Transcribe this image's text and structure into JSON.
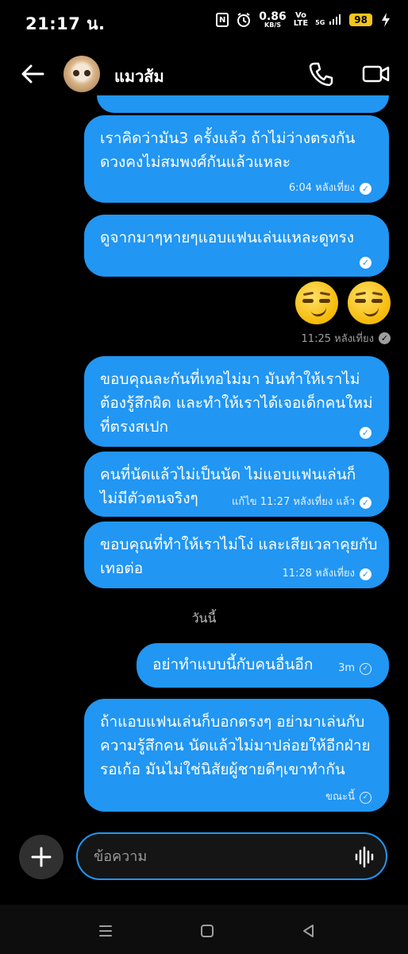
{
  "status": {
    "time": "21:17 น.",
    "net_speed": "0.86",
    "net_unit": "KB/S",
    "volte_top": "Vo",
    "volte_bottom": "LTE",
    "network": "5G",
    "battery": "98",
    "icons": [
      "nfc-icon",
      "alarm-icon",
      "signal-icon",
      "wifi-icon",
      "battery-icon"
    ]
  },
  "header": {
    "contact_name": "แมวส้ม",
    "icons": [
      "back-arrow-icon",
      "phone-icon",
      "video-call-icon"
    ]
  },
  "messages": [
    {
      "text": "เราคิดว่ามัน3 ครั้งแล้ว ถ้าไม่ว่างตรงกัน ดวงคงไม่สมพงศ์กันแล้วแหละ",
      "meta": "6:04 หลังเที่ยง"
    },
    {
      "text": "ดูจากมาๆหายๆแอบแฟนเล่นแหละดูทรง",
      "meta": ""
    },
    {
      "text": "😏😏",
      "meta": "11:25 หลังเที่ยง"
    },
    {
      "text": "ขอบคุณละกันที่เทอไม่มา มันทำให้เราไม่ต้องรู้สึกผิด และทำให้เราได้เจอเด็กคนใหม่ที่ตรงสเปก",
      "meta": ""
    },
    {
      "text": "คนที่นัดแล้วไม่เป็นนัด ไม่แอบแฟนเล่นก็ไม่มีตัวตนจริงๆ",
      "meta": "แก้ไข 11:27 หลังเที่ยง แล้ว"
    },
    {
      "text": "ขอบคุณที่ทำให้เราไม่โง่ และเสียเวลาคุยกับเทอต่อ",
      "meta": "11:28 หลังเที่ยง"
    },
    {
      "text": "อย่าทำแบบนี้กับคนอื่นอีก",
      "meta": "3m"
    },
    {
      "text": "ถ้าแอบแฟนเล่นก็บอกตรงๆ อย่ามาเล่นกับความรู้สึกคน นัดแล้วไม่มาปล่อยให้อีกฝ่ายรอเก้อ มันไม่ใช่นิสัยผู้ชายดีๆเขาทำกัน",
      "meta": "ขณะนี้"
    }
  ],
  "date_separator": "วันนี้",
  "composer": {
    "placeholder": "ข้อความ",
    "icons": [
      "plus-icon",
      "voice-message-icon"
    ]
  },
  "navbar": {
    "icons": [
      "recent-apps-icon",
      "home-icon",
      "back-icon"
    ]
  },
  "colors": {
    "bubble": "#2196f3",
    "background": "#000000",
    "battery": "#f5c518"
  }
}
